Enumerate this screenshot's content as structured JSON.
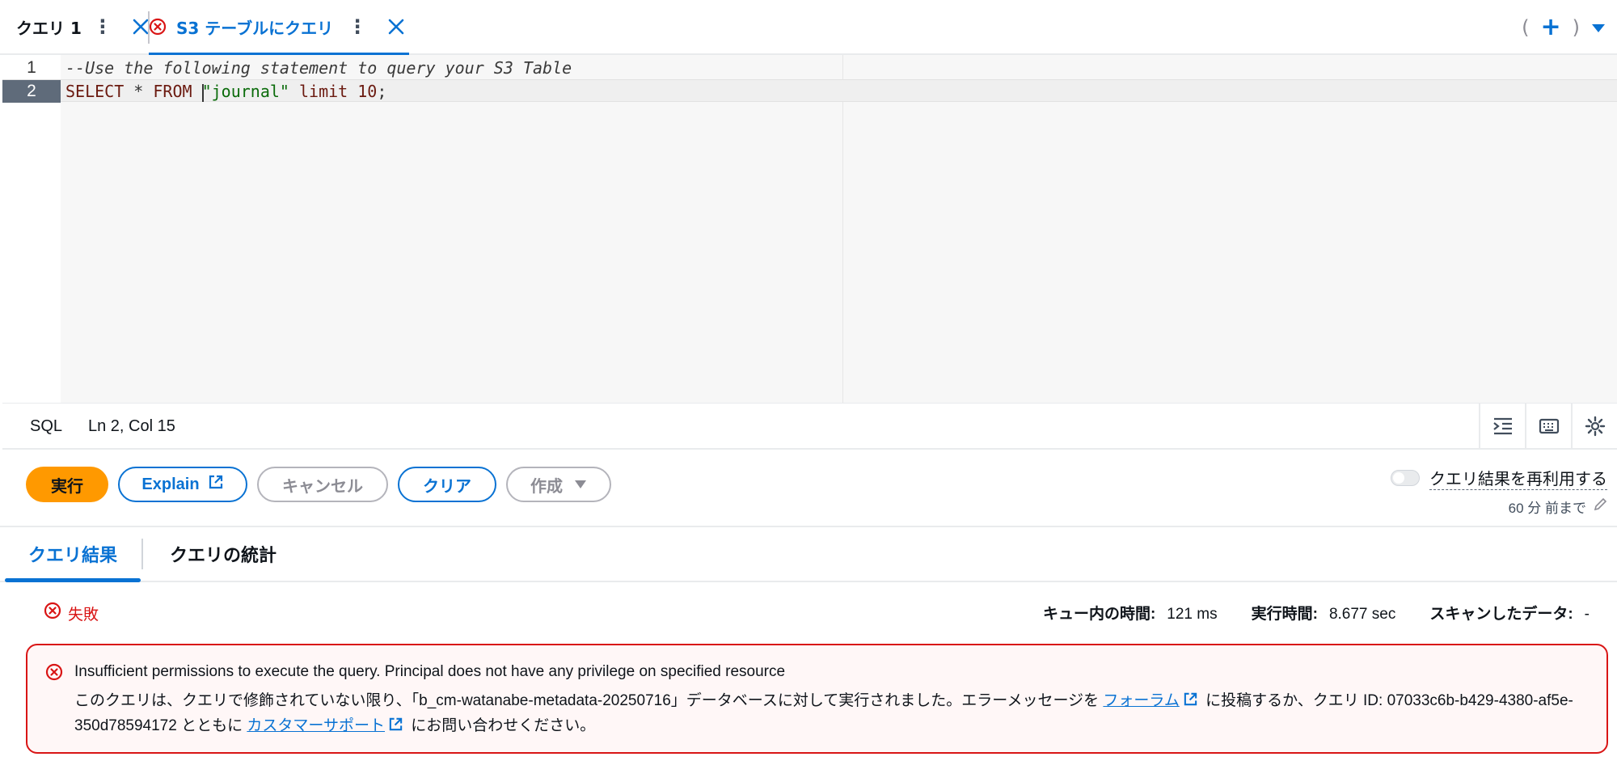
{
  "tabs": [
    {
      "label": "クエリ 1",
      "has_error": false,
      "active": false
    },
    {
      "label": "S3 テーブルにクエリ",
      "has_error": true,
      "active": true
    }
  ],
  "tab_tools": {
    "left_paren": "(",
    "plus": "+",
    "right_paren": ")"
  },
  "editor": {
    "lines": [
      {
        "number": "1",
        "text": "--Use the following statement to query your S3 Table"
      },
      {
        "number": "2",
        "kw1": "SELECT",
        "star": " * ",
        "kw2": "FROM",
        "space": " ",
        "str": "\"journal\"",
        "kw3": " limit ",
        "num": "10",
        "semi": ";"
      }
    ]
  },
  "statusbar": {
    "language": "SQL",
    "position": "Ln 2, Col 15"
  },
  "actions": {
    "run": "実行",
    "explain": "Explain",
    "cancel": "キャンセル",
    "clear": "クリア",
    "create": "作成",
    "reuse_label": "クエリ結果を再利用する",
    "reuse_age": "60 分 前まで"
  },
  "results_tabs": [
    "クエリ結果",
    "クエリの統計"
  ],
  "result_status": {
    "status": "失敗",
    "queue_label": "キュー内の時間:",
    "queue_value": "121 ms",
    "exec_label": "実行時間:",
    "exec_value": "8.677 sec",
    "scan_label": "スキャンしたデータ:",
    "scan_value": "-"
  },
  "alert": {
    "title": "Insufficient permissions to execute the query. Principal does not have any privilege on specified resource",
    "body_part1": "このクエリは、クエリで修飾されていない限り、「b_cm-watanabe-metadata-20250716」データベースに対して実行されました。エラーメッセージを ",
    "forum_link": "フォーラム",
    "body_part2": " に投稿するか、クエリ ID: 07033c6b-b429-4380-af5e-350d78594172 とともに ",
    "support_link": "カスタマーサポート",
    "body_part3": " にお問い合わせください。"
  },
  "colors": {
    "accent": "#0972d3",
    "run_button": "#ff9900",
    "error": "#d91515"
  }
}
